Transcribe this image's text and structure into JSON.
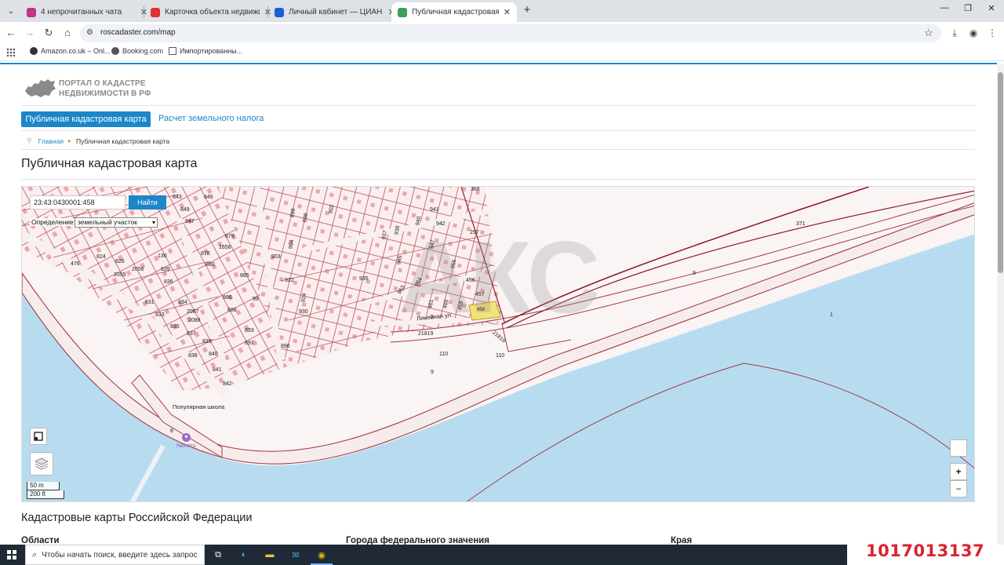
{
  "browser": {
    "tabs": [
      {
        "title": "4 непрочитанных чата",
        "favicon_color": "#c13584",
        "active": false
      },
      {
        "title": "Карточка объекта недвижимости",
        "favicon_color": "#e03030",
        "active": false
      },
      {
        "title": "Личный кабинет — ЦИАН",
        "favicon_color": "#1a5fd6",
        "active": false
      },
      {
        "title": "Публичная кадастровая карта",
        "favicon_color": "#3aa05a",
        "active": true
      }
    ],
    "url": "roscadaster.com/map",
    "bookmarks": [
      {
        "label": "Amazon.co.uk – Onl...",
        "icon": "amazon-icon"
      },
      {
        "label": "Booking.com",
        "icon": "globe-icon"
      },
      {
        "label": "Импортированны...",
        "icon": "folder-icon"
      }
    ]
  },
  "site": {
    "logo_line1": "ПОРТАЛ О КАДАСТРЕ",
    "logo_line2": "НЕДВИЖИМОСТИ В РФ",
    "nav": {
      "active": "Публичная кадастровая карта",
      "other": "Расчет земельного налога"
    },
    "breadcrumb": {
      "home": "Главная",
      "current": "Публичная кадастровая карта"
    },
    "page_title": "Публичная кадастровая карта"
  },
  "map": {
    "search_value": "23:43:0430001:458",
    "search_button": "Найти",
    "definition_label": "Определение:",
    "definition_value": "земельный участок",
    "scale_metric": "50 m",
    "scale_imperial": "200 ft",
    "zoom_in": "+",
    "zoom_out": "−",
    "watermark": "АКС",
    "labels": {
      "parcel_297": "297",
      "parcel_371": "371",
      "parcel_9a": "9",
      "parcel_1": "1",
      "parcel_21819a": "21819",
      "parcel_21819b": "21819",
      "parcel_110a": "110",
      "parcel_110b": "110",
      "parcel_9b": "9",
      "parcel_8": "8",
      "parcel_368": "368",
      "parcel_457": "457",
      "parcel_456": "456",
      "parcel_458": "458",
      "parcel_461": "461",
      "parcel_460": "460",
      "parcel_459": "459",
      "parcel_843": "843",
      "parcel_849": "849",
      "parcel_846": "846",
      "parcel_847": "847",
      "parcel_835": "835",
      "parcel_834": "834",
      "parcel_833": "833",
      "parcel_839": "839",
      "parcel_840": "840",
      "parcel_841": "841",
      "parcel_842": "842",
      "parcel_879": "879",
      "parcel_878": "878",
      "parcel_880": "880",
      "parcel_885": "885",
      "parcel_886": "886",
      "parcel_888": "888",
      "parcel_891": "891",
      "parcel_893": "893",
      "parcel_896": "896",
      "parcel_899": "899",
      "parcel_898": "898",
      "parcel_902": "902",
      "parcel_903": "903",
      "parcel_904": "904",
      "parcel_922": "922",
      "parcel_924": "924",
      "parcel_930": "930",
      "parcel_935": "935",
      "parcel_937": "937",
      "parcel_938": "938",
      "parcel_940": "940",
      "parcel_941": "941",
      "parcel_942": "942",
      "parcel_945": "945",
      "parcel_947": "947",
      "parcel_955": "955",
      "parcel_964": "964",
      "parcel_963": "963",
      "parcel_826": "826",
      "parcel_824": "824",
      "parcel_2055": "2055",
      "parcel_2056": "2056",
      "parcel_831": "831",
      "parcel_836": "836",
      "parcel_837": "837",
      "parcel_838": "838",
      "parcel_2087": "2087",
      "parcel_2088": "2088",
      "parcel_1656": "1656",
      "parcel_476": "476",
      "parcel_130": "130",
      "parcel_99": "99",
      "street_linejnaya": "Линейная ул.",
      "street_school": "Популярная школа",
      "poi_label": "Navetru"
    }
  },
  "below": {
    "section_title": "Кадастровые карты Российской Федерации",
    "col1": "Области",
    "col2": "Города федерального значения",
    "col3": "Края"
  },
  "taskbar": {
    "search_placeholder": "Чтобы начать поиск, введите здесь запрос"
  },
  "listing_id": "1017013137",
  "colors": {
    "accent": "#1b86c9",
    "water": "#b7dcf0",
    "parcel_line": "#a23b46",
    "selected_parcel": "#f2e27a",
    "id_red": "#d9232e"
  }
}
